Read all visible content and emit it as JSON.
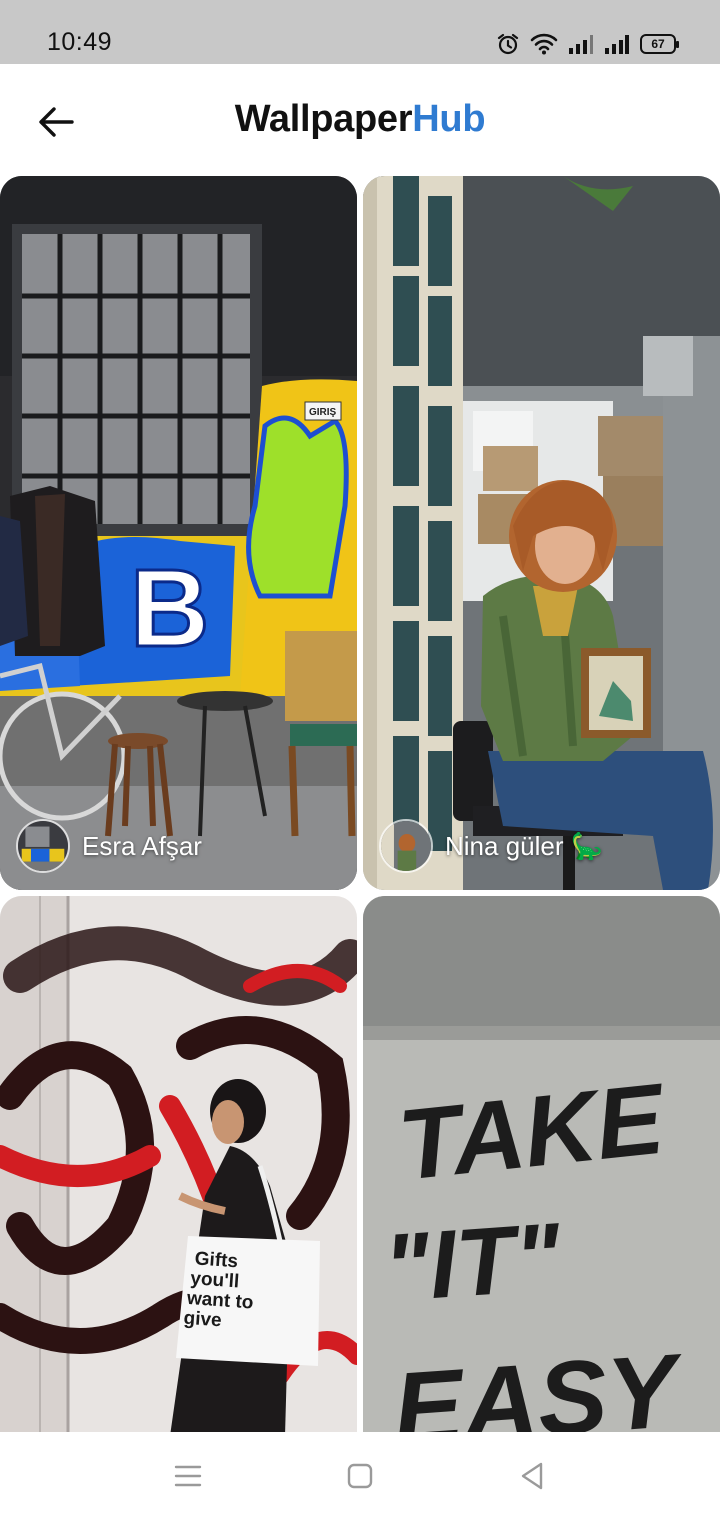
{
  "status_bar": {
    "time": "10:49",
    "battery_level": "67",
    "icons": [
      "alarm-icon",
      "wifi-icon",
      "signal-icon",
      "signal-icon",
      "battery-icon"
    ]
  },
  "app_bar": {
    "title_main": "Wallpaper",
    "title_accent": "Hub",
    "accent_color": "#2f7bd1",
    "back_icon": "arrow-left-icon"
  },
  "wallpapers": [
    {
      "author": "Esra Afşar",
      "subject": "graffiti wall with barred window, bicycle, chair"
    },
    {
      "author": "Nina güler 🦕",
      "subject": "woman in green cardigan seated holding framed picture"
    },
    {
      "author": "",
      "subject": "woman with tote bag walking past graffiti wall"
    },
    {
      "author": "",
      "subject": "TAKE IT EASY graffiti on concrete wall"
    }
  ],
  "photo_text": {
    "tote_bag": [
      "Gifts",
      "you'll",
      "want to",
      "give"
    ],
    "graffiti": [
      "TAKE",
      "\"IT\"",
      "EASY"
    ],
    "sign": "GIRIŞ"
  },
  "nav_bar": {
    "buttons": [
      "menu-icon",
      "home-icon",
      "back-triangle-icon"
    ]
  }
}
